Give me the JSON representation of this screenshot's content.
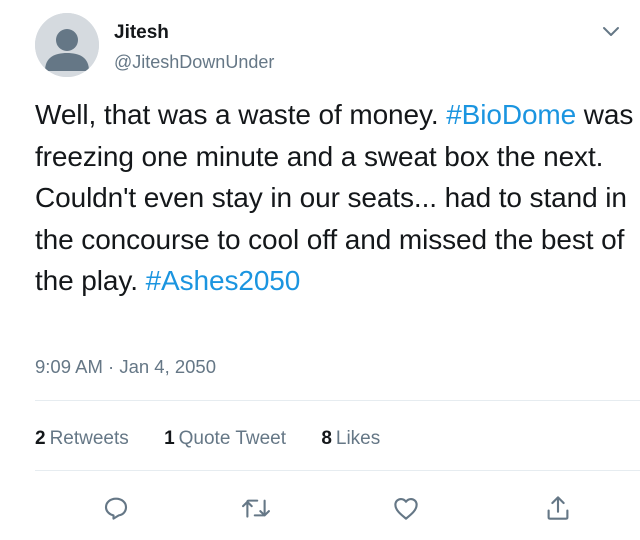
{
  "author": {
    "display_name": "Jitesh",
    "handle": "@JiteshDownUnder"
  },
  "tweet": {
    "segments": [
      {
        "type": "text",
        "text": "Well, that was a waste of money. "
      },
      {
        "type": "hashtag",
        "text": "#BioDome"
      },
      {
        "type": "text",
        "text": " was freezing one minute and a sweat box the next. Couldn't even stay in our seats... had to stand in the concourse to cool off and missed the best of the play. "
      },
      {
        "type": "hashtag",
        "text": "#Ashes2050"
      }
    ],
    "timestamp": "9:09 AM · Jan 4, 2050"
  },
  "stats": {
    "retweets_count": "2",
    "retweets_label": "Retweets",
    "quote_count": "1",
    "quote_label": "Quote Tweet",
    "likes_count": "8",
    "likes_label": "Likes"
  },
  "actions": {
    "reply_icon": "reply-icon",
    "retweet_icon": "retweet-icon",
    "like_icon": "heart-icon",
    "share_icon": "share-icon"
  },
  "colors": {
    "hashtag": "#1b95e0",
    "secondary_text": "#657786",
    "primary_text": "#14171a",
    "divider": "#e6ecf0",
    "icon": "#657786"
  }
}
